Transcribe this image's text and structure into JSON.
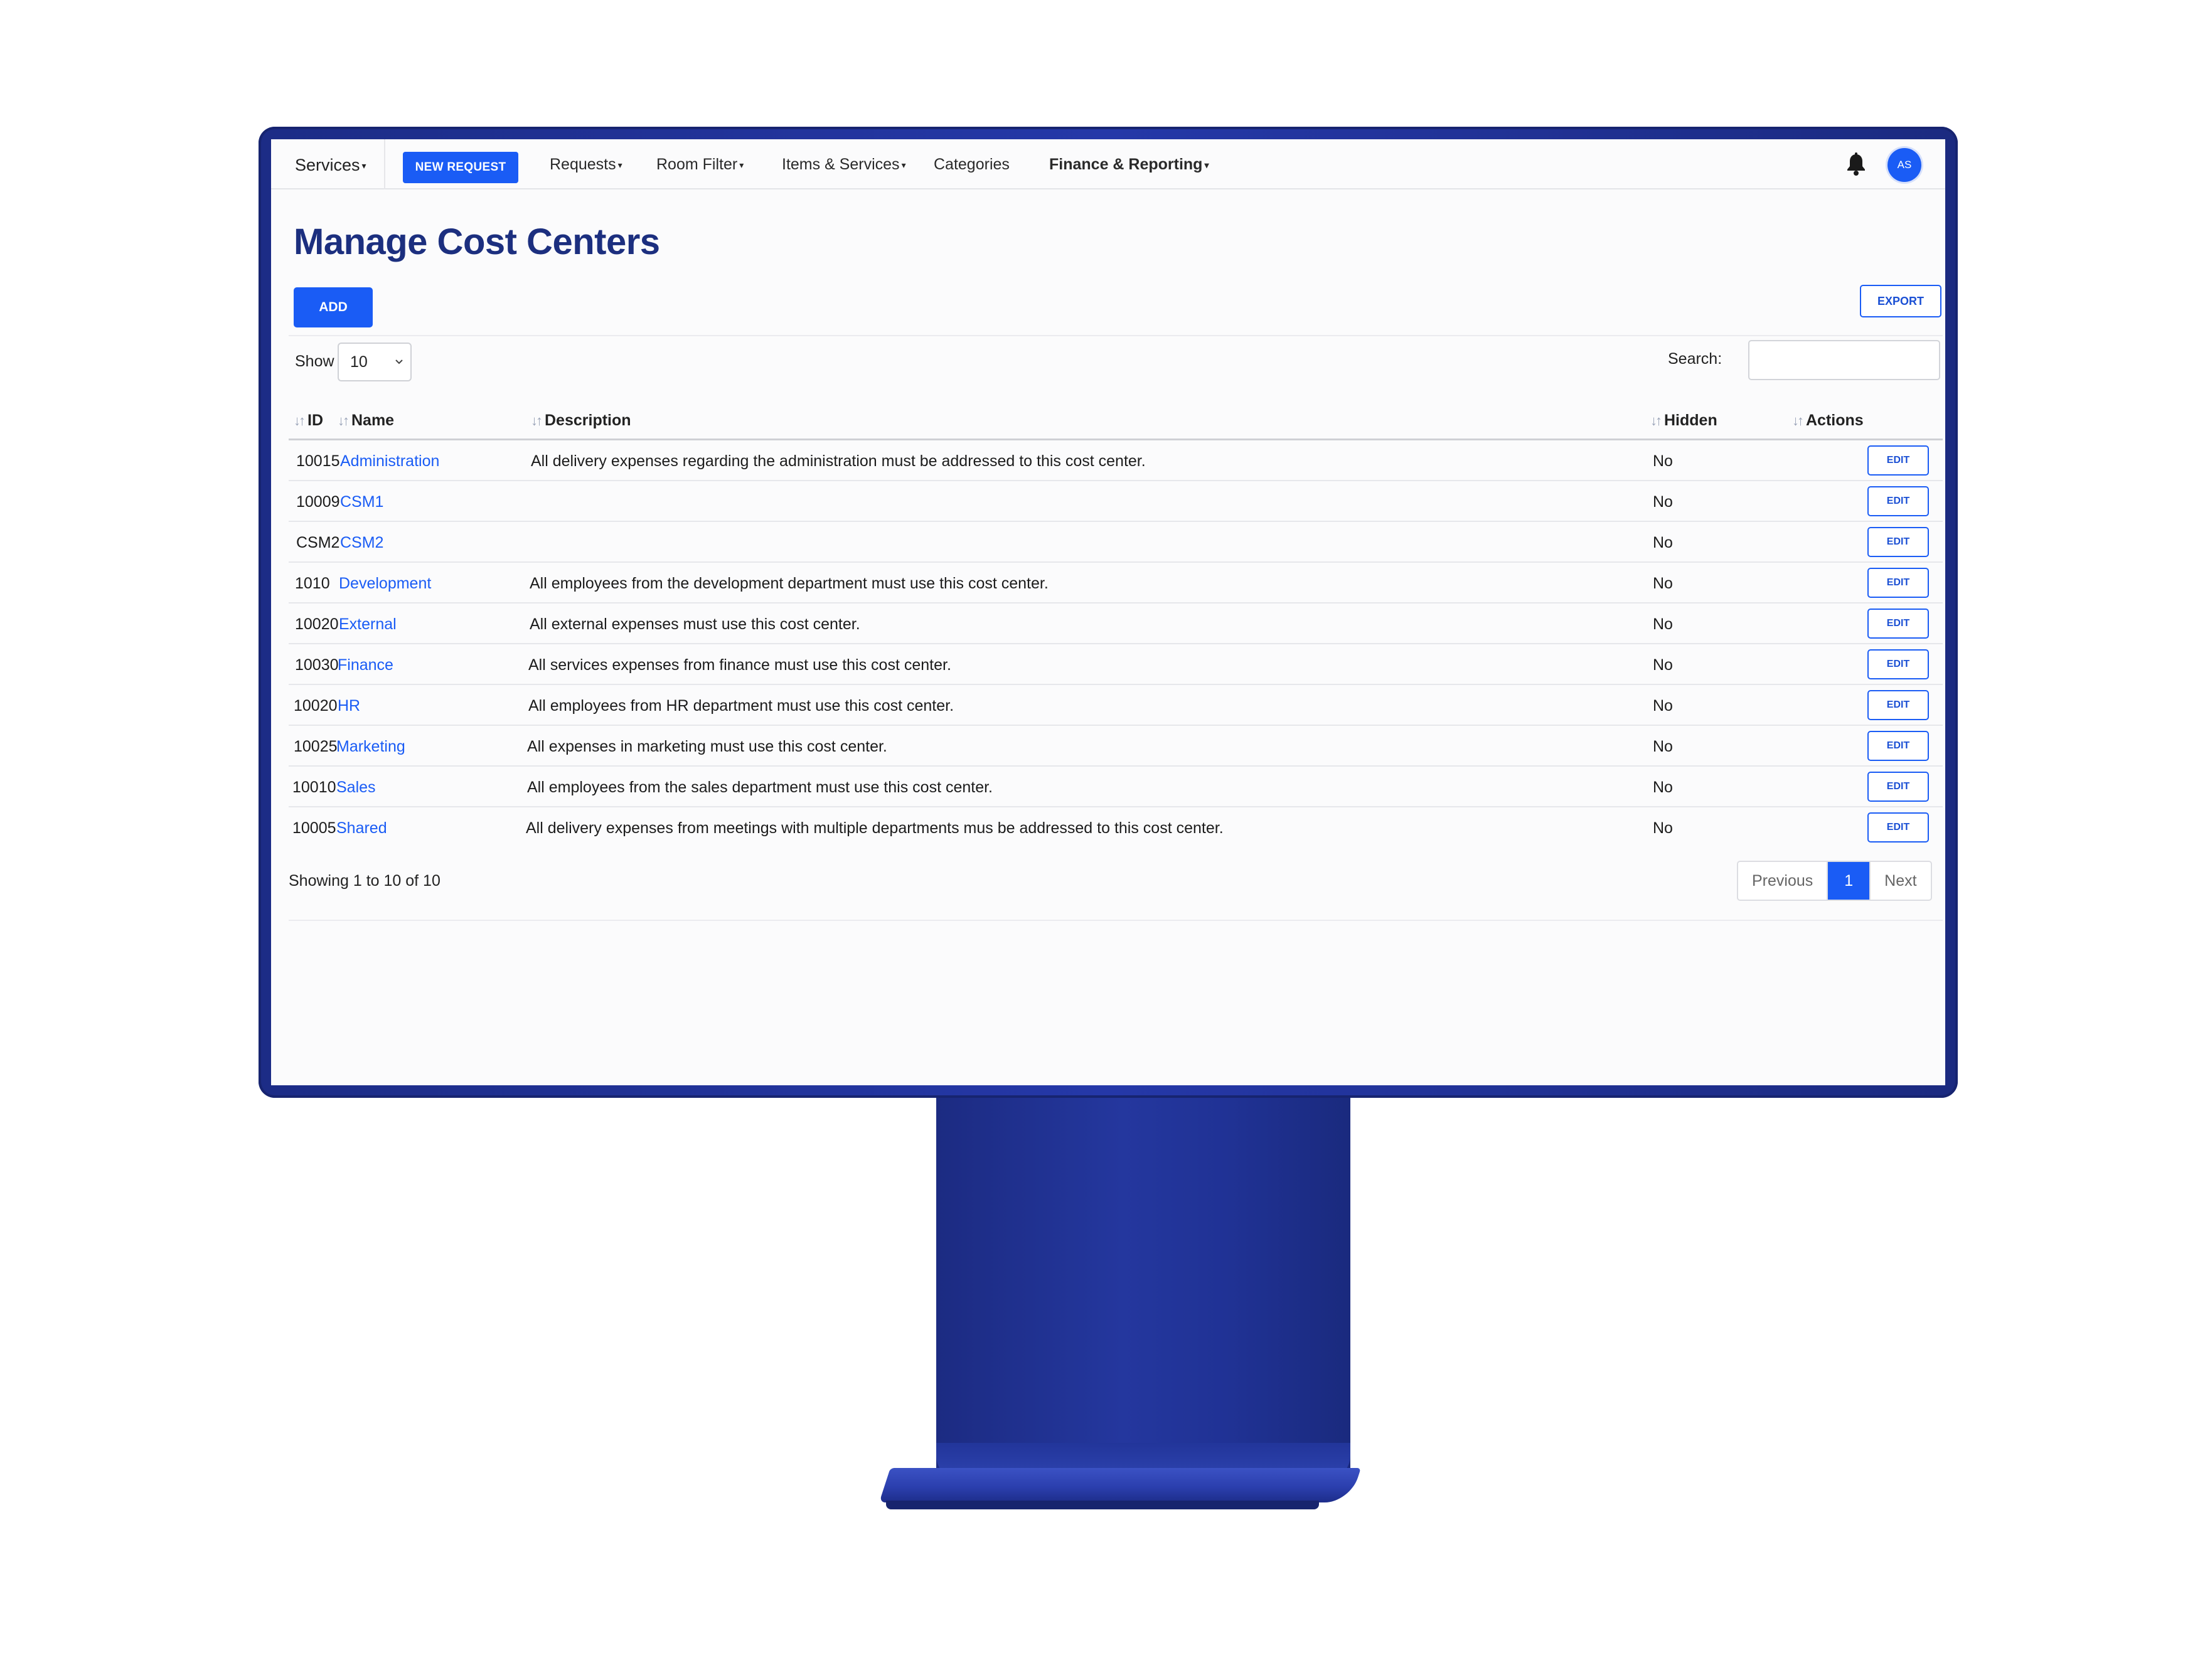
{
  "nav": {
    "services": "Services",
    "new_request": "NEW REQUEST",
    "requests": "Requests",
    "room_filter": "Room Filter",
    "items_services": "Items & Services",
    "categories": "Categories",
    "finance_reporting": "Finance & Reporting",
    "avatar_initials": "AS",
    "caret_glyph": "▾"
  },
  "page": {
    "title": "Manage Cost Centers",
    "add_label": "ADD",
    "export_label": "EXPORT"
  },
  "controls": {
    "show_label": "Show",
    "show_value": "10",
    "search_label": "Search:",
    "search_value": ""
  },
  "table": {
    "headers": {
      "id": "ID",
      "name": "Name",
      "description": "Description",
      "hidden": "Hidden",
      "actions": "Actions"
    },
    "rows": [
      {
        "id": "10015",
        "name": "Administration",
        "description": "All delivery expenses regarding the administration must be addressed to this cost center.",
        "hidden": "No",
        "action": "EDIT"
      },
      {
        "id": "10009",
        "name": "CSM1",
        "description": "",
        "hidden": "No",
        "action": "EDIT"
      },
      {
        "id": "CSM2",
        "name": "CSM2",
        "description": "",
        "hidden": "No",
        "action": "EDIT"
      },
      {
        "id": "1010",
        "name": "Development",
        "description": "All employees from the development department must use this cost center.",
        "hidden": "No",
        "action": "EDIT"
      },
      {
        "id": "10020",
        "name": "External",
        "description": "All external expenses must use this cost center.",
        "hidden": "No",
        "action": "EDIT"
      },
      {
        "id": "10030",
        "name": "Finance",
        "description": "All services expenses from finance must use this cost center.",
        "hidden": "No",
        "action": "EDIT"
      },
      {
        "id": "10020",
        "name": "HR",
        "description": "All employees from HR department must use this cost center.",
        "hidden": "No",
        "action": "EDIT"
      },
      {
        "id": "10025",
        "name": "Marketing",
        "description": "All expenses in marketing must use this cost center.",
        "hidden": "No",
        "action": "EDIT"
      },
      {
        "id": "10010",
        "name": "Sales",
        "description": "All employees from the sales department must use this cost center.",
        "hidden": "No",
        "action": "EDIT"
      },
      {
        "id": "10005",
        "name": "Shared",
        "description": "All delivery expenses from meetings with multiple departments mus be addressed to this cost center.",
        "hidden": "No",
        "action": "EDIT"
      }
    ]
  },
  "footer": {
    "showing": "Showing 1 to 10 of 10",
    "previous": "Previous",
    "current_page": "1",
    "next": "Next"
  },
  "colors": {
    "accent": "#1a5cf5",
    "title": "#1c2f7f",
    "monitor": "#2538a8"
  }
}
